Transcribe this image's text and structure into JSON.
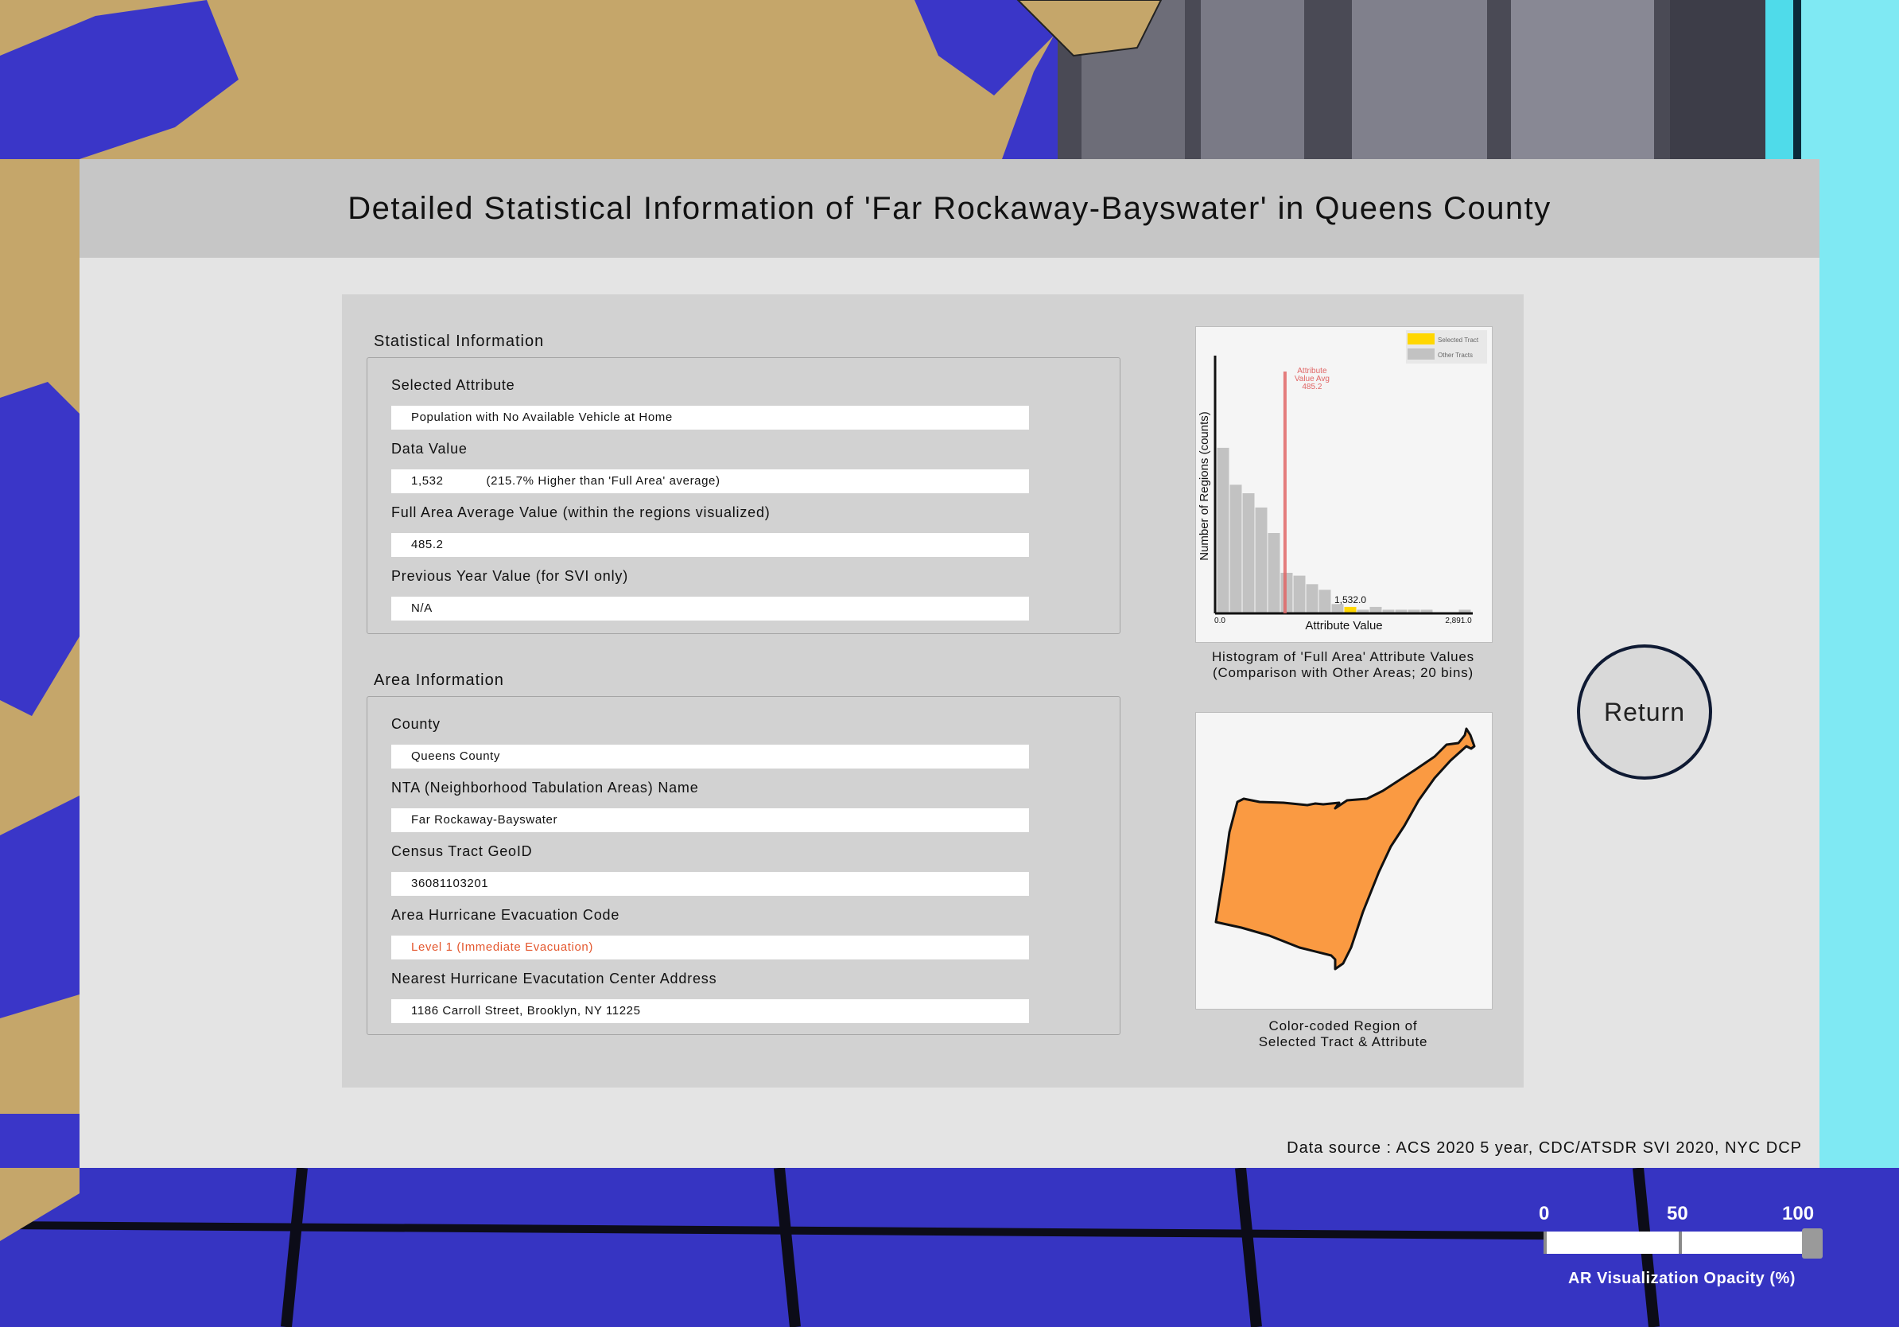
{
  "header": {
    "title": "Detailed Statistical Information of 'Far Rockaway-Bayswater' in Queens County"
  },
  "statistical_info": {
    "legend": "Statistical Information",
    "fields": [
      {
        "label": "Selected Attribute",
        "value": "Population with No Available Vehicle at Home",
        "note": ""
      },
      {
        "label": "Data Value",
        "value": "1,532",
        "note": "(215.7% Higher than 'Full Area' average)"
      },
      {
        "label": "Full Area Average Value (within the regions visualized)",
        "value": "485.2",
        "note": ""
      },
      {
        "label": "Previous Year Value (for SVI only)",
        "value": "N/A",
        "note": ""
      }
    ]
  },
  "area_info": {
    "legend": "Area Information",
    "fields": [
      {
        "label": "County",
        "value": "Queens County",
        "highlight": false
      },
      {
        "label": "NTA (Neighborhood Tabulation Areas) Name",
        "value": "Far Rockaway-Bayswater",
        "highlight": false
      },
      {
        "label": "Census Tract GeoID",
        "value": "36081103201",
        "highlight": false
      },
      {
        "label": "Area Hurricane Evacuation Code",
        "value": "Level 1 (Immediate Evacuation)",
        "highlight": true
      },
      {
        "label": "Nearest Hurricane Evacutation Center Address",
        "value": "1186 Carroll Street, Brooklyn, NY 11225",
        "highlight": false
      }
    ]
  },
  "chart_data": {
    "type": "bar",
    "title": "",
    "xlabel": "Attribute Value",
    "ylabel": "Number of Regions (counts)",
    "x_tick_labels": [
      "0.0",
      "2,891.0"
    ],
    "xlim": [
      0,
      2891
    ],
    "bins": 20,
    "values": [
      58,
      45,
      42,
      37,
      28,
      14,
      13,
      10,
      8,
      3,
      2,
      1,
      2,
      1,
      1,
      1,
      1,
      0,
      0,
      1
    ],
    "selected_bin": 10,
    "selected_value_label": "1,532.0",
    "average": 485.2,
    "average_label": [
      "Attribute",
      "Value Avg",
      "485.2"
    ],
    "legend": [
      {
        "name": "Selected Tract",
        "color": "#ffd700"
      },
      {
        "name": "Other Tracts",
        "color": "#c2c2c2"
      }
    ],
    "legend_position": "top-right",
    "colors": {
      "bar": "#c2c2c2",
      "selected": "#ffd700",
      "average_line": "#e06666"
    }
  },
  "histogram_caption": [
    "Histogram of 'Full Area' Attribute Values",
    "(Comparison with Other Areas; 20 bins)"
  ],
  "map_caption": [
    "Color-coded Region of",
    "Selected Tract & Attribute"
  ],
  "map_colors": {
    "fill": "#fa9a42",
    "stroke": "#111111"
  },
  "return_label": "Return",
  "data_source": "Data source : ACS 2020 5 year, CDC/ATSDR SVI 2020, NYC DCP",
  "opacity_slider": {
    "ticks": [
      "0",
      "50",
      "100"
    ],
    "value": 100,
    "caption": "AR Visualization Opacity (%)"
  }
}
